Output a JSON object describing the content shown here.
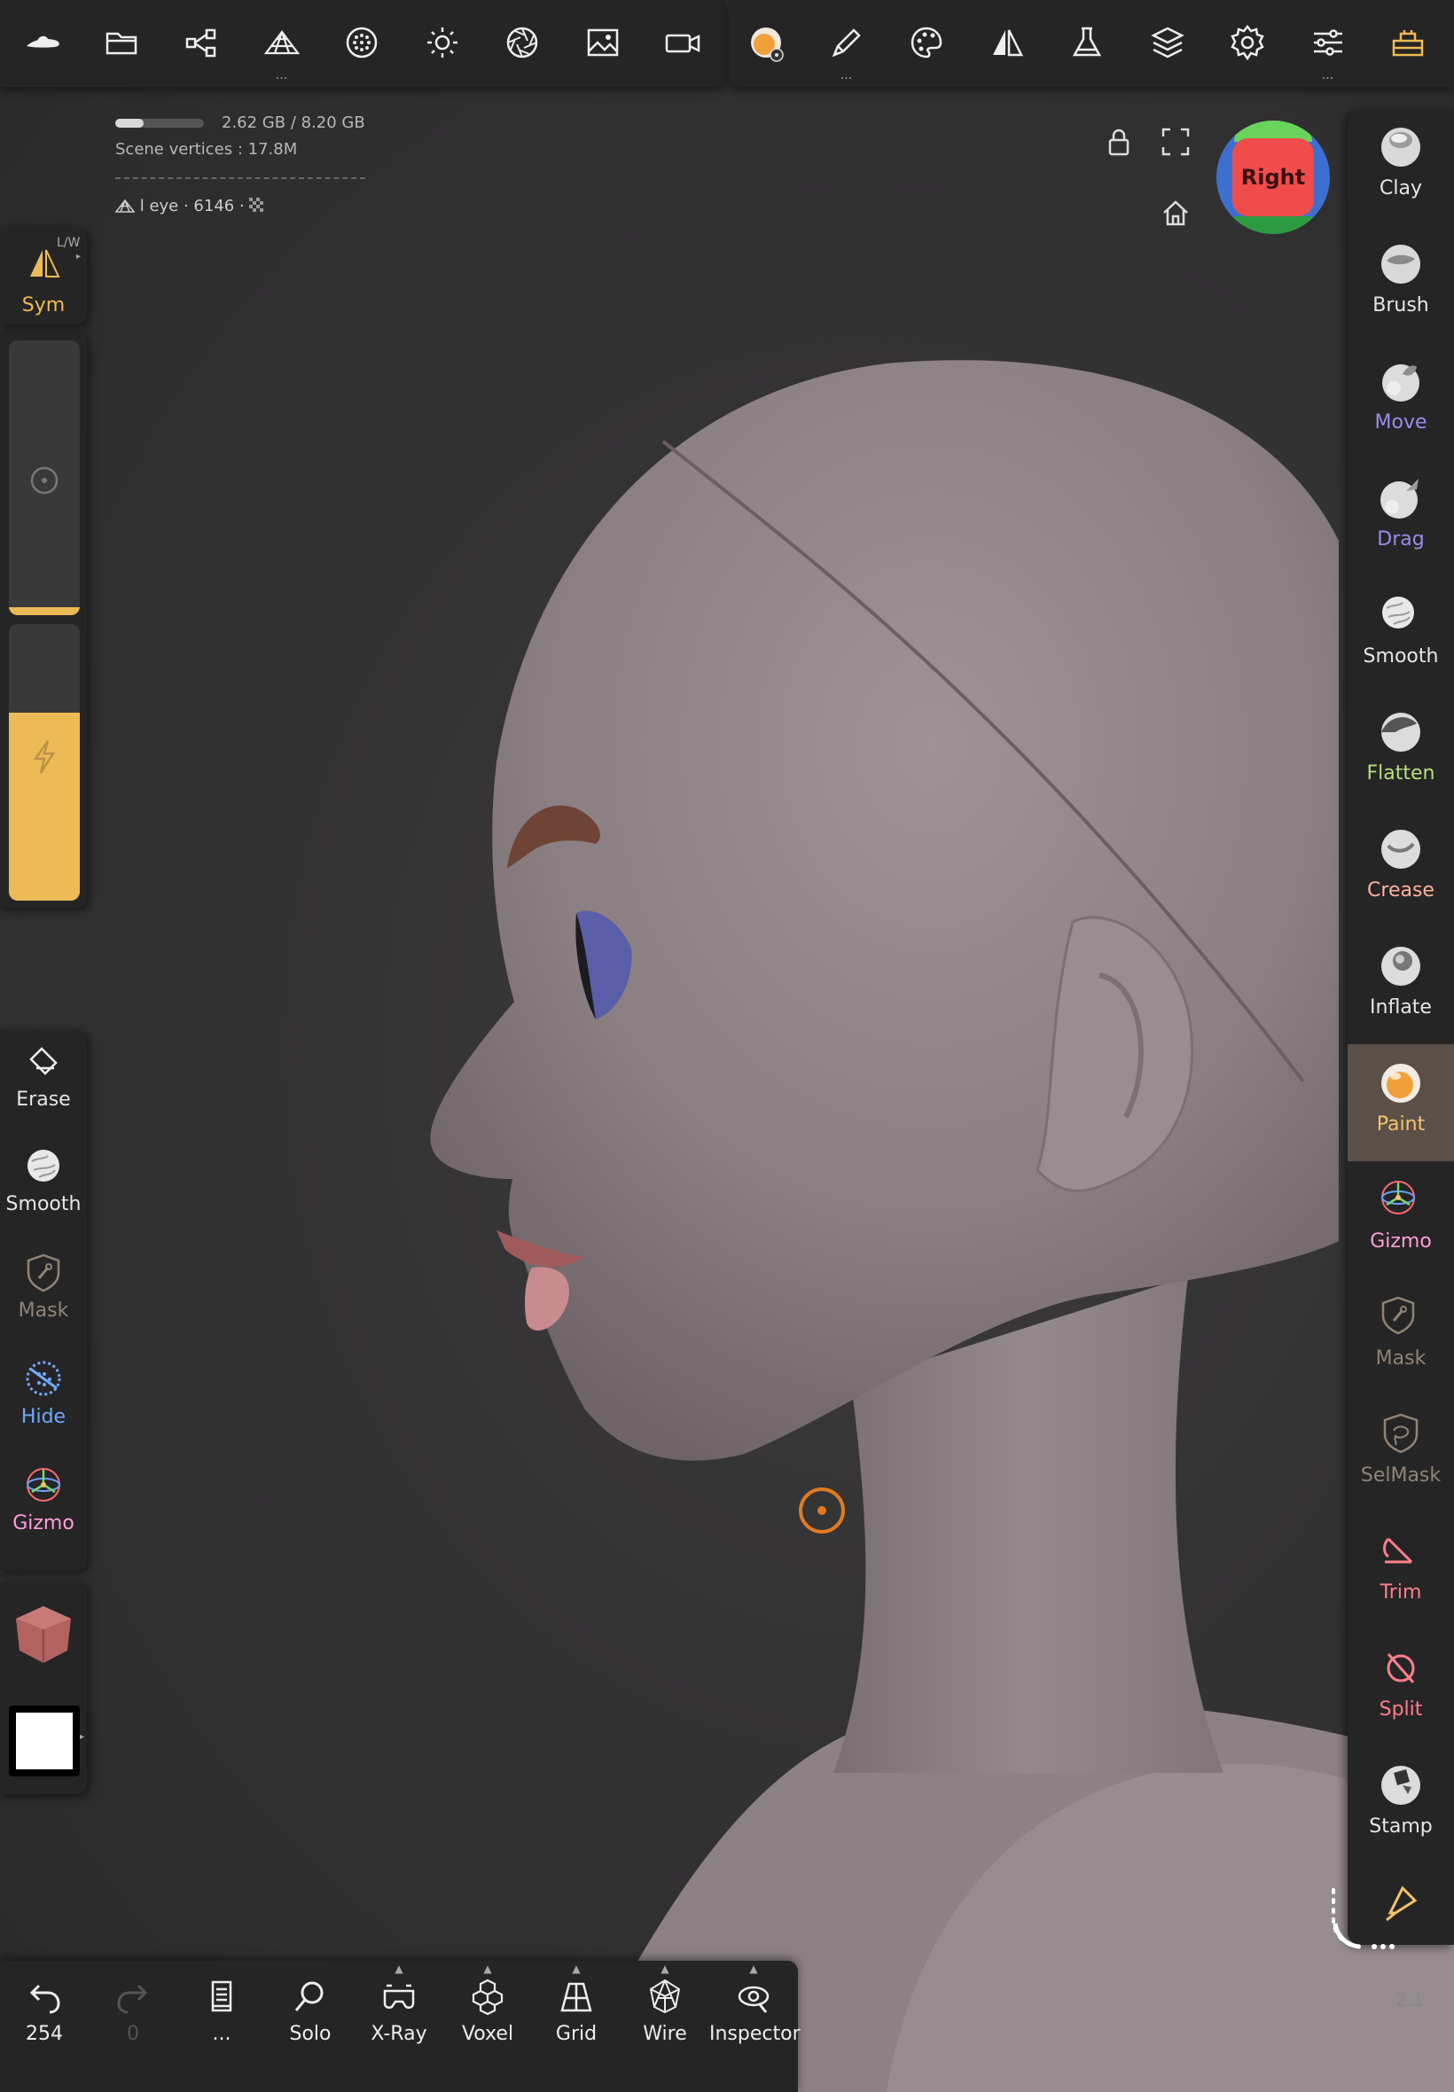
{
  "topbar": {
    "left_tools": [
      {
        "icon": "nomad-logo-icon"
      },
      {
        "icon": "folder-icon"
      },
      {
        "icon": "scene-graph-icon"
      },
      {
        "icon": "topology-icon",
        "more": "..."
      },
      {
        "icon": "material-sphere-icon"
      },
      {
        "icon": "light-icon"
      },
      {
        "icon": "camera-aperture-icon"
      },
      {
        "icon": "background-image-icon"
      },
      {
        "icon": "video-camera-icon"
      }
    ],
    "right_tools": [
      {
        "icon": "paint-material-icon"
      },
      {
        "icon": "stroke-icon",
        "more": "..."
      },
      {
        "icon": "palette-icon"
      },
      {
        "icon": "symmetry-icon"
      },
      {
        "icon": "flask-icon"
      },
      {
        "icon": "layers-icon"
      },
      {
        "icon": "settings-icon"
      },
      {
        "icon": "sliders-icon",
        "more": "..."
      },
      {
        "icon": "interface-icon"
      }
    ]
  },
  "info": {
    "memory": "2.62 GB / 8.20 GB",
    "memory_used_fraction": 0.32,
    "vertices": "Scene vertices :  17.8M",
    "object": "l eye · 6146 ·"
  },
  "navcube": {
    "face": "Right"
  },
  "left_panel": {
    "sym_label": "Sym",
    "sym_badge": "L/W",
    "radius_fraction": 0.03,
    "intensity_fraction": 0.68,
    "tools": [
      {
        "label": "Erase",
        "icon": "eraser-icon",
        "color": "#e6e6e6"
      },
      {
        "label": "Smooth",
        "icon": "smooth-icon",
        "color": "#e6e6e6"
      },
      {
        "label": "Mask",
        "icon": "mask-icon",
        "color": "#8f8476"
      },
      {
        "label": "Hide",
        "icon": "hide-icon",
        "color": "#6fa8ff"
      },
      {
        "label": "Gizmo",
        "icon": "gizmo-icon",
        "color": "#ff9edb"
      }
    ]
  },
  "right_panel": {
    "tools": [
      {
        "label": "Clay",
        "icon": "clay-icon",
        "color": "#e6e6e6"
      },
      {
        "label": "Brush",
        "icon": "brush-icon",
        "color": "#e6e6e6"
      },
      {
        "label": "Move",
        "icon": "move-icon",
        "color": "#9a8ce8"
      },
      {
        "label": "Drag",
        "icon": "drag-icon",
        "color": "#9a8ce8"
      },
      {
        "label": "Smooth",
        "icon": "smooth-icon",
        "color": "#e6e6e6"
      },
      {
        "label": "Flatten",
        "icon": "flatten-icon",
        "color": "#b7e07a"
      },
      {
        "label": "Crease",
        "icon": "crease-icon",
        "color": "#ffb39e"
      },
      {
        "label": "Inflate",
        "icon": "inflate-icon",
        "color": "#e6e6e6"
      },
      {
        "label": "Paint",
        "icon": "paint-icon",
        "color": "#f3c36b",
        "active": true
      },
      {
        "label": "Gizmo",
        "icon": "gizmo-icon",
        "color": "#ff9edb"
      },
      {
        "label": "Mask",
        "icon": "mask-icon",
        "color": "#8f8476"
      },
      {
        "label": "SelMask",
        "icon": "selmask-icon",
        "color": "#8f8476"
      },
      {
        "label": "Trim",
        "icon": "trim-icon",
        "color": "#ff7f8a"
      },
      {
        "label": "Split",
        "icon": "split-icon",
        "color": "#ff7f8a"
      },
      {
        "label": "Stamp",
        "icon": "stamp-icon",
        "color": "#e6e6e6"
      },
      {
        "label": "",
        "icon": "tube-icon",
        "color": "#f3c36b"
      }
    ]
  },
  "bottombar": {
    "tools": [
      {
        "label": "254",
        "icon": "undo-icon",
        "dim": false
      },
      {
        "label": "0",
        "icon": "redo-icon",
        "dim": true
      },
      {
        "label": "...",
        "icon": "history-icon",
        "dim": false
      },
      {
        "label": "Solo",
        "icon": "solo-icon",
        "dim": false
      },
      {
        "label": "X-Ray",
        "icon": "xray-icon",
        "dim": false,
        "caret": true
      },
      {
        "label": "Voxel",
        "icon": "voxel-icon",
        "dim": false,
        "caret": true
      },
      {
        "label": "Grid",
        "icon": "grid-icon",
        "dim": false,
        "caret": true
      },
      {
        "label": "Wire",
        "icon": "wireframe-icon",
        "dim": false,
        "caret": true
      },
      {
        "label": "Inspector",
        "icon": "inspector-icon",
        "dim": false,
        "caret": true
      }
    ]
  },
  "version": "2.1",
  "colors": {
    "accent": "#edbb55",
    "panel": "#262526",
    "background": "#333233",
    "paint_color": "#ffffff"
  }
}
